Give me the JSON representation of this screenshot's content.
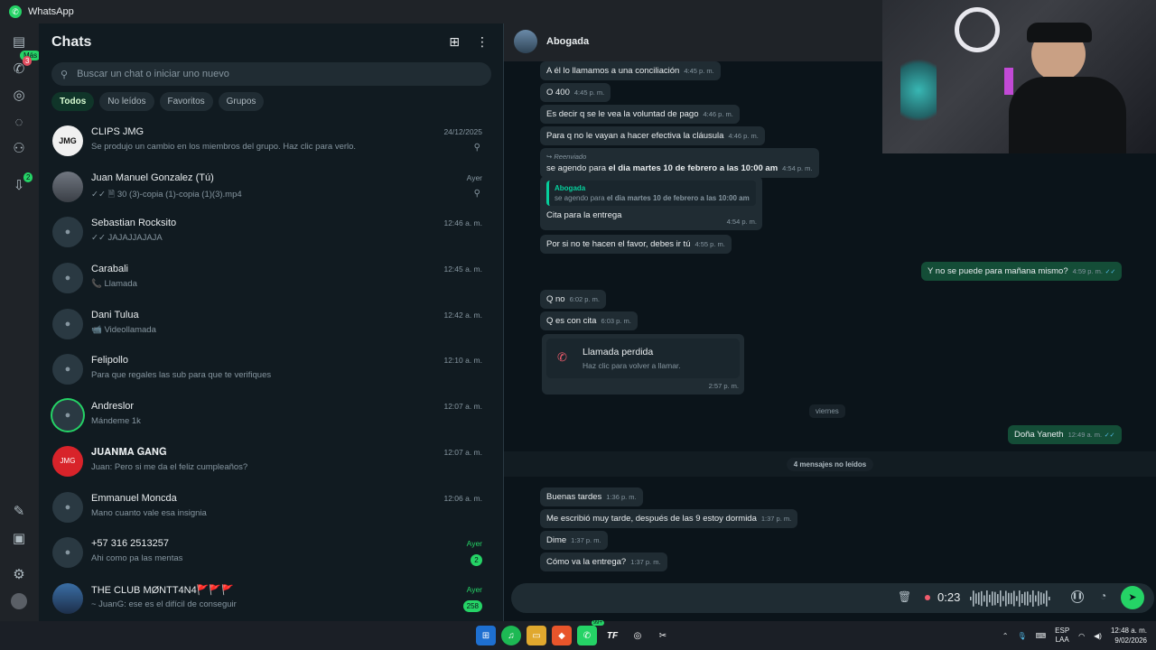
{
  "window": {
    "title": "WhatsApp"
  },
  "rail": {
    "mas_badge": "Más",
    "calls_badge": "3",
    "updates_badge": "2"
  },
  "chatlist": {
    "title": "Chats",
    "search_placeholder": "Buscar un chat o iniciar uno nuevo",
    "filters": [
      "Todos",
      "No leídos",
      "Favoritos",
      "Grupos"
    ],
    "chats": [
      {
        "name": "CLIPS JMG",
        "last": "Se produjo un cambio en los miembros del grupo. Haz clic para verlo.",
        "time": "24/12/2025",
        "pinned": true
      },
      {
        "name": "Juan Manuel Gonzalez (Tú)",
        "last": "✓✓ 🗎 30 (3)-copia (1)-copia (1)(3).mp4",
        "time": "Ayer",
        "pinned": true
      },
      {
        "name": "Sebastian Rocksito",
        "last": "✓✓ JAJAJJAJAJA",
        "time": "12:46 a. m."
      },
      {
        "name": "Carabali",
        "last": "📞 Llamada",
        "time": "12:45 a. m."
      },
      {
        "name": "Dani Tulua",
        "last": "📹 Videollamada",
        "time": "12:42 a. m."
      },
      {
        "name": "Felipollo",
        "last": "Para que regales las sub para que te verifiques",
        "time": "12:10 a. m."
      },
      {
        "name": "Andreslor",
        "last": "Mándeme 1k",
        "time": "12:07 a. m."
      },
      {
        "name": "𝐉𝐔𝐀𝐍𝐌𝐀 𝐆𝐀𝐍𝐆",
        "last": "Juan: Pero si me da el feliz cumpleaños?",
        "time": "12:07 a. m."
      },
      {
        "name": "Emmanuel Moncda",
        "last": "Mano cuanto vale esa insignia",
        "time": "12:06 a. m."
      },
      {
        "name": "+57 316 2513257",
        "last": "Ahi como pa las mentas",
        "time": "Ayer",
        "unread": "2"
      },
      {
        "name": "THE CLUB MØNTT4N4🚩🚩🚩",
        "last": "~ JuanG: ese es el difícil de conseguir",
        "time": "Ayer",
        "unread": "258"
      }
    ]
  },
  "chat": {
    "contact": "Abogada",
    "messages": [
      {
        "text": "A él lo llamamos a una conciliación",
        "time": "4:45 p. m."
      },
      {
        "text": "O 400",
        "time": "4:45 p. m."
      },
      {
        "text": "Es decir q se le vea la voluntad de pago",
        "time": "4:46 p. m."
      },
      {
        "text": "Para q no le vayan a hacer efectiva la cláusula",
        "time": "4:46 p. m."
      },
      {
        "forwarded": "Reenviado",
        "text_pre": "se agendo para ",
        "text_bold": "el dia martes 10 de febrero a las 10:00 am",
        "time": "4:54 p. m."
      },
      {
        "quote_name": "Abogada",
        "quote_pre": "se agendo para ",
        "quote_bold": "el dia martes 10 de febrero a las 10:00 am",
        "text": "Cita para la entrega",
        "time": "4:54 p. m."
      },
      {
        "text": "Por si no te hacen el favor, debes ir tú",
        "time": "4:55 p. m."
      },
      {
        "text": "Y no se puede para mañana mismo?",
        "time": "4:59 p. m.",
        "out": true
      },
      {
        "text": "Q no",
        "time": "6:02 p. m."
      },
      {
        "text": "Q es con cita",
        "time": "6:03 p. m."
      },
      {
        "text": "Doña Yaneth",
        "time": "12:49 a. m.",
        "out": true
      },
      {
        "text": "Buenas tardes",
        "time": "1:36 p. m."
      },
      {
        "text": "Me escribió muy tarde, después de las 9 estoy dormida",
        "time": "1:37 p. m."
      },
      {
        "text": "Dime",
        "time": "1:37 p. m."
      },
      {
        "text": "Cómo va la entrega?",
        "time": "1:37 p. m."
      }
    ],
    "missed_call": {
      "title": "Llamada perdida",
      "subtitle": "Haz clic para volver a llamar.",
      "time": "2:57 p. m."
    },
    "day_separator": "viernes",
    "unread_banner": "4 mensajes no leídos",
    "recording": {
      "duration": "0:23"
    }
  },
  "taskbar": {
    "lang": "ESP",
    "layout": "LAA",
    "time": "12:48 a. m.",
    "date": "9/02/2026",
    "wa_badge": "99+"
  }
}
